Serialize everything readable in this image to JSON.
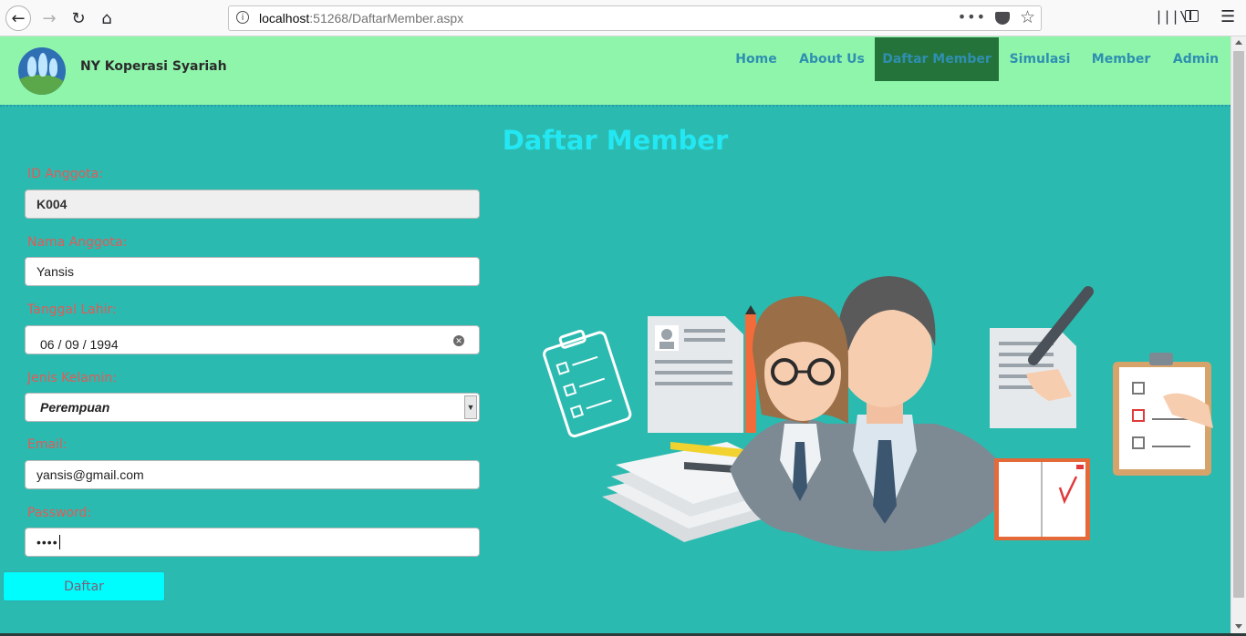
{
  "browser": {
    "url_host": "localhost",
    "url_rest": ":51268/DaftarMember.aspx",
    "more_label": "•••"
  },
  "header": {
    "brand": "NY Koperasi Syariah",
    "menu": [
      "Home",
      "About Us",
      "Daftar Member",
      "Simulasi",
      "Member",
      "Admin"
    ],
    "active": "Daftar Member"
  },
  "form": {
    "title": "Daftar Member",
    "id_label": "ID Anggota:",
    "id_value": "K004",
    "name_label": "Nama Anggota:",
    "name_value": "Yansis",
    "dob_label": "Tanggal Lahir:",
    "dob_value": "06 / 09 / 1994",
    "gender_label": "Jenis Kelamin:",
    "gender_value": "Perempuan",
    "email_label": "Email:",
    "email_value": "yansis@gmail.com",
    "password_label": "Password:",
    "password_value": "••••",
    "submit_label": "Daftar"
  },
  "colors": {
    "page_bg": "#2bbab0",
    "header_bg": "#8ff5ab",
    "active_menu_bg": "#24733b",
    "menu_text": "#2f8fb0",
    "title_text": "#23e7f2",
    "label_text": "#e35a57",
    "button_bg": "#00fdfd"
  }
}
